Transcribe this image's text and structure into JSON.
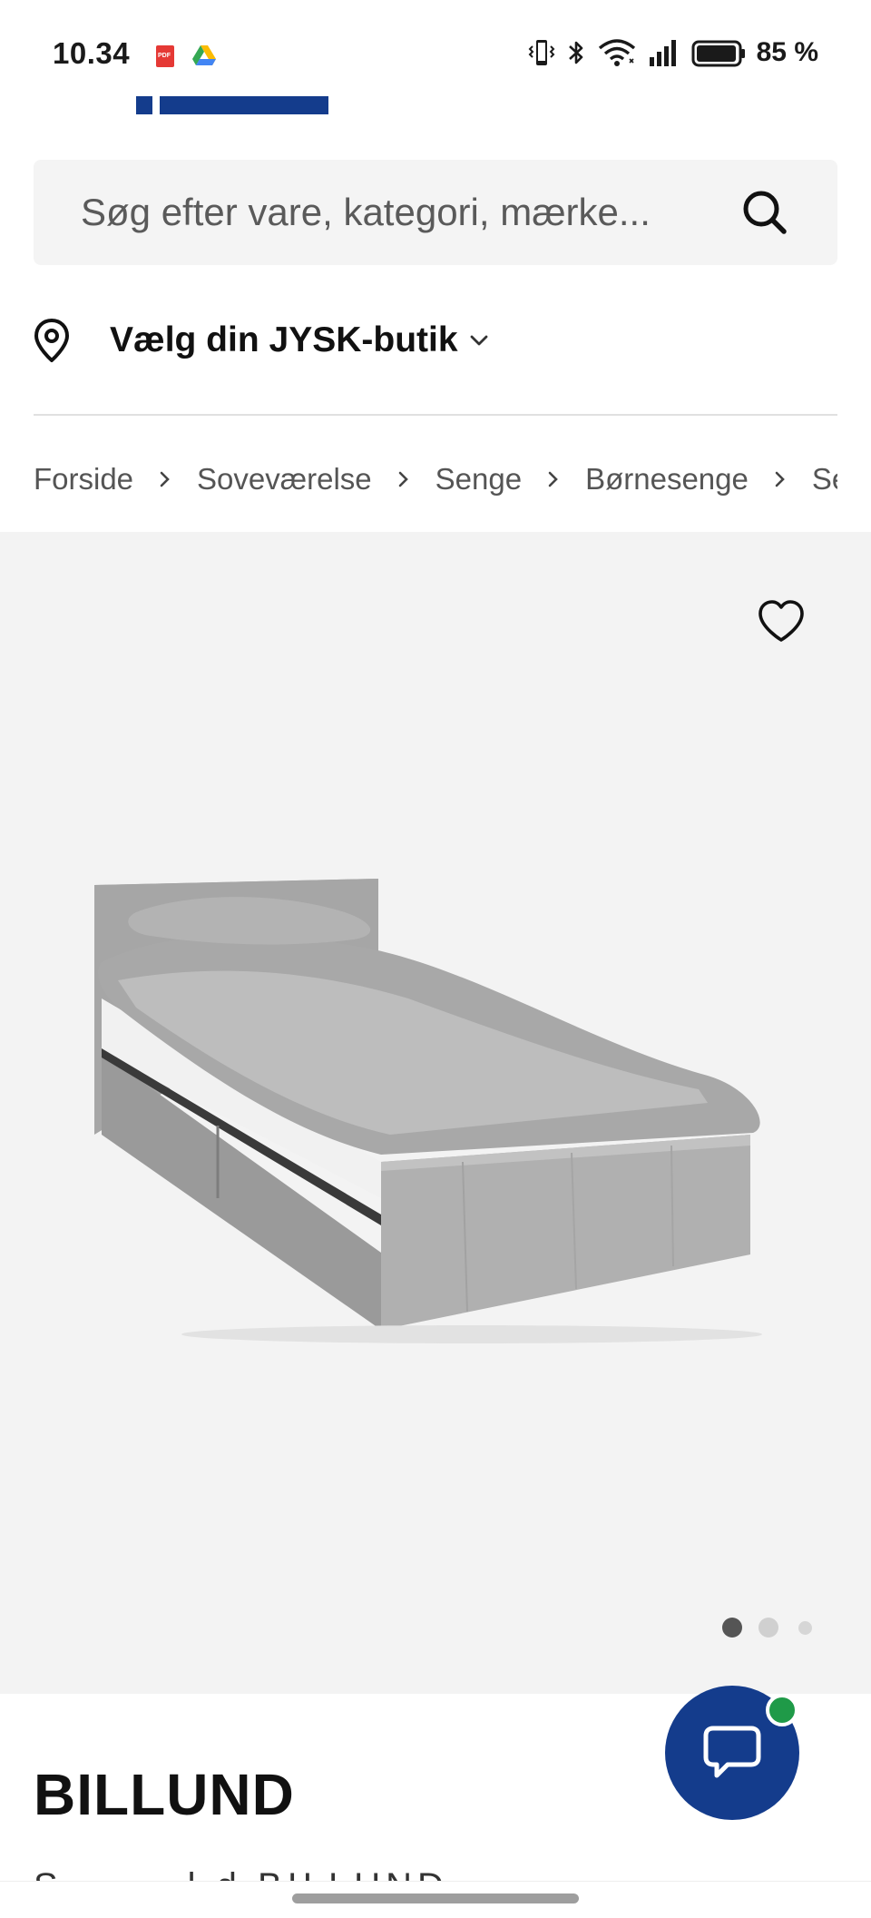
{
  "status_bar": {
    "time": "10.34",
    "battery_percent": "85 %",
    "notification_icons": [
      "pdf-icon",
      "drive-icon"
    ],
    "system_icons": [
      "vibrate-icon",
      "bluetooth-icon",
      "wifi-icon",
      "signal-icon",
      "battery-icon"
    ]
  },
  "search": {
    "placeholder": "Søg efter vare, kategori, mærke..."
  },
  "store": {
    "label": "Vælg din JYSK-butik"
  },
  "breadcrumb": {
    "items": [
      "Forside",
      "Soveværelse",
      "Senge",
      "Børnesenge",
      "Seng"
    ]
  },
  "gallery": {
    "image_count": 3,
    "active_index": 0
  },
  "product": {
    "title": "BILLUND",
    "description_partial": "S  ......  l  d  BILLUND"
  },
  "colors": {
    "brand_blue": "#143c8c",
    "chat_badge": "#1f9a48",
    "gallery_bg": "#f3f3f3",
    "search_bg": "#f4f4f4"
  }
}
